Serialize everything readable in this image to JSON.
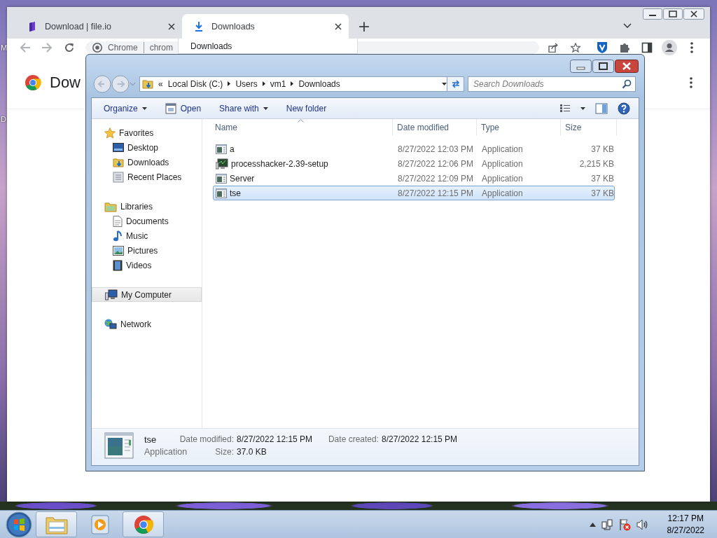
{
  "desktop": {
    "icon_labels": [
      "M",
      "D"
    ]
  },
  "browser": {
    "tabs": [
      {
        "title": "Download | file.io",
        "selected": false
      },
      {
        "title": "Downloads",
        "selected": true
      }
    ],
    "new_tab": "+",
    "omnibox": {
      "site": "Chrome",
      "url": "chrom"
    },
    "tab_menu": {
      "title": "Downloads"
    },
    "page": {
      "title": "Dow"
    }
  },
  "explorer": {
    "breadcrumb": {
      "overflow": "«",
      "parts": [
        "Local Disk (C:)",
        "Users",
        "vm1",
        "Downloads"
      ]
    },
    "search": {
      "placeholder": "Search Downloads"
    },
    "toolbar": [
      {
        "label": "Organize",
        "kind": "menu"
      },
      {
        "label": "Open",
        "kind": "action"
      },
      {
        "label": "Share with",
        "kind": "menu"
      },
      {
        "label": "New folder",
        "kind": "plain"
      }
    ],
    "sidebar": [
      {
        "label": "Favorites",
        "selected": false,
        "children": [
          {
            "label": "Desktop",
            "selected": false
          },
          {
            "label": "Downloads",
            "selected": false
          },
          {
            "label": "Recent Places",
            "selected": false
          }
        ]
      },
      {
        "label": "Libraries",
        "selected": false,
        "children": [
          {
            "label": "Documents",
            "selected": false
          },
          {
            "label": "Music",
            "selected": false
          },
          {
            "label": "Pictures",
            "selected": false
          },
          {
            "label": "Videos",
            "selected": false
          }
        ]
      },
      {
        "label": "My Computer",
        "selected": true
      },
      {
        "label": "Network",
        "selected": false
      }
    ],
    "columns": [
      {
        "label": "Name",
        "sorted": true
      },
      {
        "label": "Date modified",
        "sorted": false
      },
      {
        "label": "Type",
        "sorted": false
      },
      {
        "label": "Size",
        "sorted": false
      }
    ],
    "files": [
      {
        "name": "a",
        "date_modified": "8/27/2022 12:03 PM",
        "type": "Application",
        "size": "37 KB",
        "kind": "app",
        "selected": false
      },
      {
        "name": "processhacker-2.39-setup",
        "date_modified": "8/27/2022 12:06 PM",
        "type": "Application",
        "size": "2,215 KB",
        "kind": "installer",
        "selected": false
      },
      {
        "name": "Server",
        "date_modified": "8/27/2022 12:09 PM",
        "type": "Application",
        "size": "37 KB",
        "kind": "app",
        "selected": false
      },
      {
        "name": "tse",
        "date_modified": "8/27/2022 12:15 PM",
        "type": "Application",
        "size": "37 KB",
        "kind": "app",
        "selected": true
      }
    ],
    "details": {
      "name": "tse",
      "type": "Application",
      "fields": [
        {
          "label": "Date modified:",
          "value": "8/27/2022 12:15 PM"
        },
        {
          "label": "Date created:",
          "value": "8/27/2022 12:15 PM"
        },
        {
          "label": "Size:",
          "value": "37.0 KB"
        }
      ]
    }
  },
  "taskbar": {
    "buttons": [
      {
        "kind": "explorer",
        "active": true
      },
      {
        "kind": "media",
        "active": false
      },
      {
        "kind": "chrome",
        "active": true
      }
    ],
    "clock": {
      "time": "12:17 PM",
      "date": "8/27/2022"
    }
  }
}
